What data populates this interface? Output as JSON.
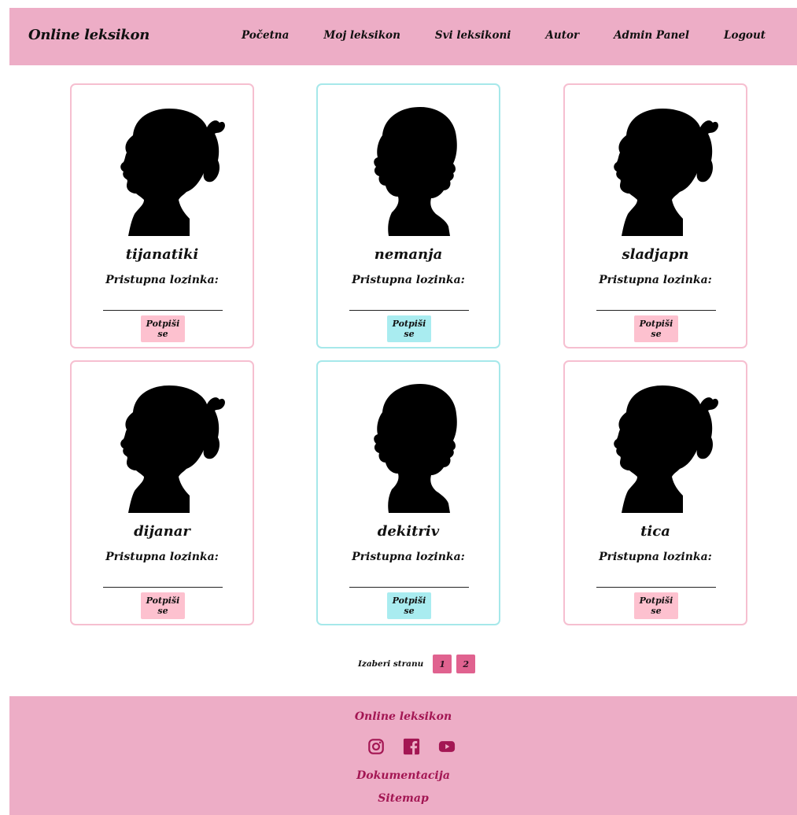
{
  "navbar": {
    "brand": "Online leksikon",
    "links": [
      {
        "label": "Početna"
      },
      {
        "label": "Moj leksikon"
      },
      {
        "label": "Svi leksikoni"
      },
      {
        "label": "Autor"
      },
      {
        "label": "Admin Panel"
      },
      {
        "label": "Logout"
      }
    ]
  },
  "colors": {
    "nav_bg": "#edadc6",
    "pink_accent": "#fdc1cf",
    "teal_accent": "#a9ecf0",
    "page_button": "#e0628f",
    "footer_text": "#a31653"
  },
  "cards": [
    {
      "username": "tijanatiki",
      "password_label": "Pristupna lozinka:",
      "password_value": "",
      "button_label": "Potpiši se",
      "theme": "pink",
      "avatar": "girl-silhouette-icon"
    },
    {
      "username": "nemanja",
      "password_label": "Pristupna lozinka:",
      "password_value": "",
      "button_label": "Potpiši se",
      "theme": "teal",
      "avatar": "boy-silhouette-icon"
    },
    {
      "username": "sladjapn",
      "password_label": "Pristupna lozinka:",
      "password_value": "",
      "button_label": "Potpiši se",
      "theme": "pink",
      "avatar": "girl-silhouette-icon"
    },
    {
      "username": "dijanar",
      "password_label": "Pristupna lozinka:",
      "password_value": "",
      "button_label": "Potpiši se",
      "theme": "pink",
      "avatar": "girl-silhouette-icon"
    },
    {
      "username": "dekitriv",
      "password_label": "Pristupna lozinka:",
      "password_value": "",
      "button_label": "Potpiši se",
      "theme": "teal",
      "avatar": "boy-silhouette-icon"
    },
    {
      "username": "tica",
      "password_label": "Pristupna lozinka:",
      "password_value": "",
      "button_label": "Potpiši se",
      "theme": "pink",
      "avatar": "girl-silhouette-icon"
    }
  ],
  "pagination": {
    "label": "Izaberi stranu",
    "pages": [
      "1",
      "2"
    ]
  },
  "footer": {
    "title": "Online leksikon",
    "social": [
      "instagram-icon",
      "facebook-icon",
      "youtube-icon"
    ],
    "links": [
      "Dokumentacija",
      "Sitemap"
    ]
  }
}
